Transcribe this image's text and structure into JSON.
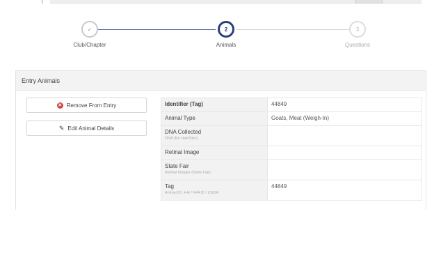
{
  "stepper": {
    "steps": [
      {
        "label": "Club/Chapter",
        "marker": "✓",
        "state": "done"
      },
      {
        "label": "Animals",
        "marker": "2",
        "state": "active"
      },
      {
        "label": "Questions",
        "marker": "3",
        "state": "todo"
      }
    ]
  },
  "panel": {
    "title": "Entry Animals",
    "remove_button": "Remove From Entry",
    "edit_button": "Edit Animal Details"
  },
  "details": [
    {
      "key": "Identifier (Tag)",
      "sub": "",
      "value": "44849"
    },
    {
      "key": "Animal Type",
      "sub": "",
      "value": "Goats, Meat (Weigh-In)"
    },
    {
      "key": "DNA Collected",
      "sub": "DNA (No Hair/Skin)",
      "value": ""
    },
    {
      "key": "Retinal Image",
      "sub": "",
      "value": ""
    },
    {
      "key": "State Fair",
      "sub": "Retinal Images (State Fair)",
      "value": ""
    },
    {
      "key": "Tag",
      "sub": "Animal ID: 4-H / FFA ID / USDA",
      "value": "44849"
    }
  ],
  "icons": {
    "remove": "remove-circle-icon",
    "edit": "pencil-icon",
    "done": "check-icon"
  },
  "colors": {
    "accent": "#2c3e7c",
    "danger": "#d0423f"
  }
}
